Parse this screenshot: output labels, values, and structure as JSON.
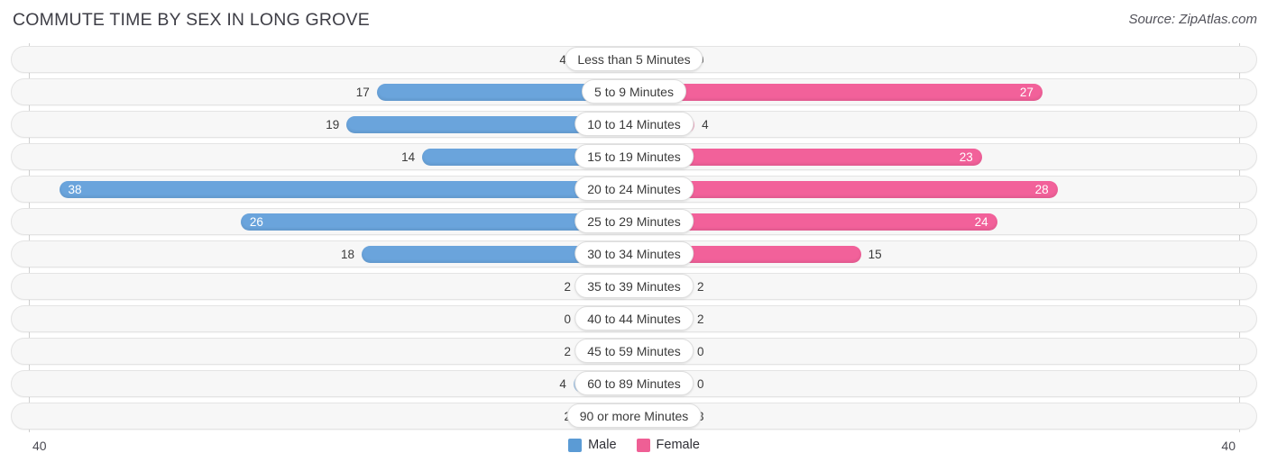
{
  "header": {
    "title": "COMMUTE TIME BY SEX IN LONG GROVE",
    "source": "Source: ZipAtlas.com"
  },
  "legend": {
    "items": [
      {
        "label": "Male",
        "color": "#5b9bd5"
      },
      {
        "label": "Female",
        "color": "#ef5f95"
      }
    ]
  },
  "axis": {
    "left_end": "40",
    "right_end": "40",
    "max": 40
  },
  "colors": {
    "male_strong": "#6aa4dc",
    "male_light": "#a6c9ec",
    "female_strong": "#f2619a",
    "female_light": "#f7a8c4",
    "track": "#f7f7f7",
    "track_border": "#e4e4e4"
  },
  "chart_data": {
    "type": "bar",
    "title": "COMMUTE TIME BY SEX IN LONG GROVE",
    "subtitle": "",
    "xlabel": "",
    "ylabel": "",
    "orientation": "horizontal-diverging",
    "xlim": [
      40,
      40
    ],
    "grid": false,
    "legend_position": "bottom-center",
    "categories": [
      "Less than 5 Minutes",
      "5 to 9 Minutes",
      "10 to 14 Minutes",
      "15 to 19 Minutes",
      "20 to 24 Minutes",
      "25 to 29 Minutes",
      "30 to 34 Minutes",
      "35 to 39 Minutes",
      "40 to 44 Minutes",
      "45 to 59 Minutes",
      "60 to 89 Minutes",
      "90 or more Minutes"
    ],
    "series": [
      {
        "name": "Male",
        "values": [
          4,
          17,
          19,
          14,
          38,
          26,
          18,
          2,
          0,
          2,
          4,
          2
        ]
      },
      {
        "name": "Female",
        "values": [
          0,
          27,
          4,
          23,
          28,
          24,
          15,
          2,
          2,
          0,
          0,
          3
        ]
      }
    ]
  },
  "rows": [
    {
      "label": "Less than 5 Minutes",
      "male": "4",
      "female": "0"
    },
    {
      "label": "5 to 9 Minutes",
      "male": "17",
      "female": "27"
    },
    {
      "label": "10 to 14 Minutes",
      "male": "19",
      "female": "4"
    },
    {
      "label": "15 to 19 Minutes",
      "male": "14",
      "female": "23"
    },
    {
      "label": "20 to 24 Minutes",
      "male": "38",
      "female": "28"
    },
    {
      "label": "25 to 29 Minutes",
      "male": "26",
      "female": "24"
    },
    {
      "label": "30 to 34 Minutes",
      "male": "18",
      "female": "15"
    },
    {
      "label": "35 to 39 Minutes",
      "male": "2",
      "female": "2"
    },
    {
      "label": "40 to 44 Minutes",
      "male": "0",
      "female": "2"
    },
    {
      "label": "45 to 59 Minutes",
      "male": "2",
      "female": "0"
    },
    {
      "label": "60 to 89 Minutes",
      "male": "4",
      "female": "0"
    },
    {
      "label": "90 or more Minutes",
      "male": "2",
      "female": "3"
    }
  ]
}
